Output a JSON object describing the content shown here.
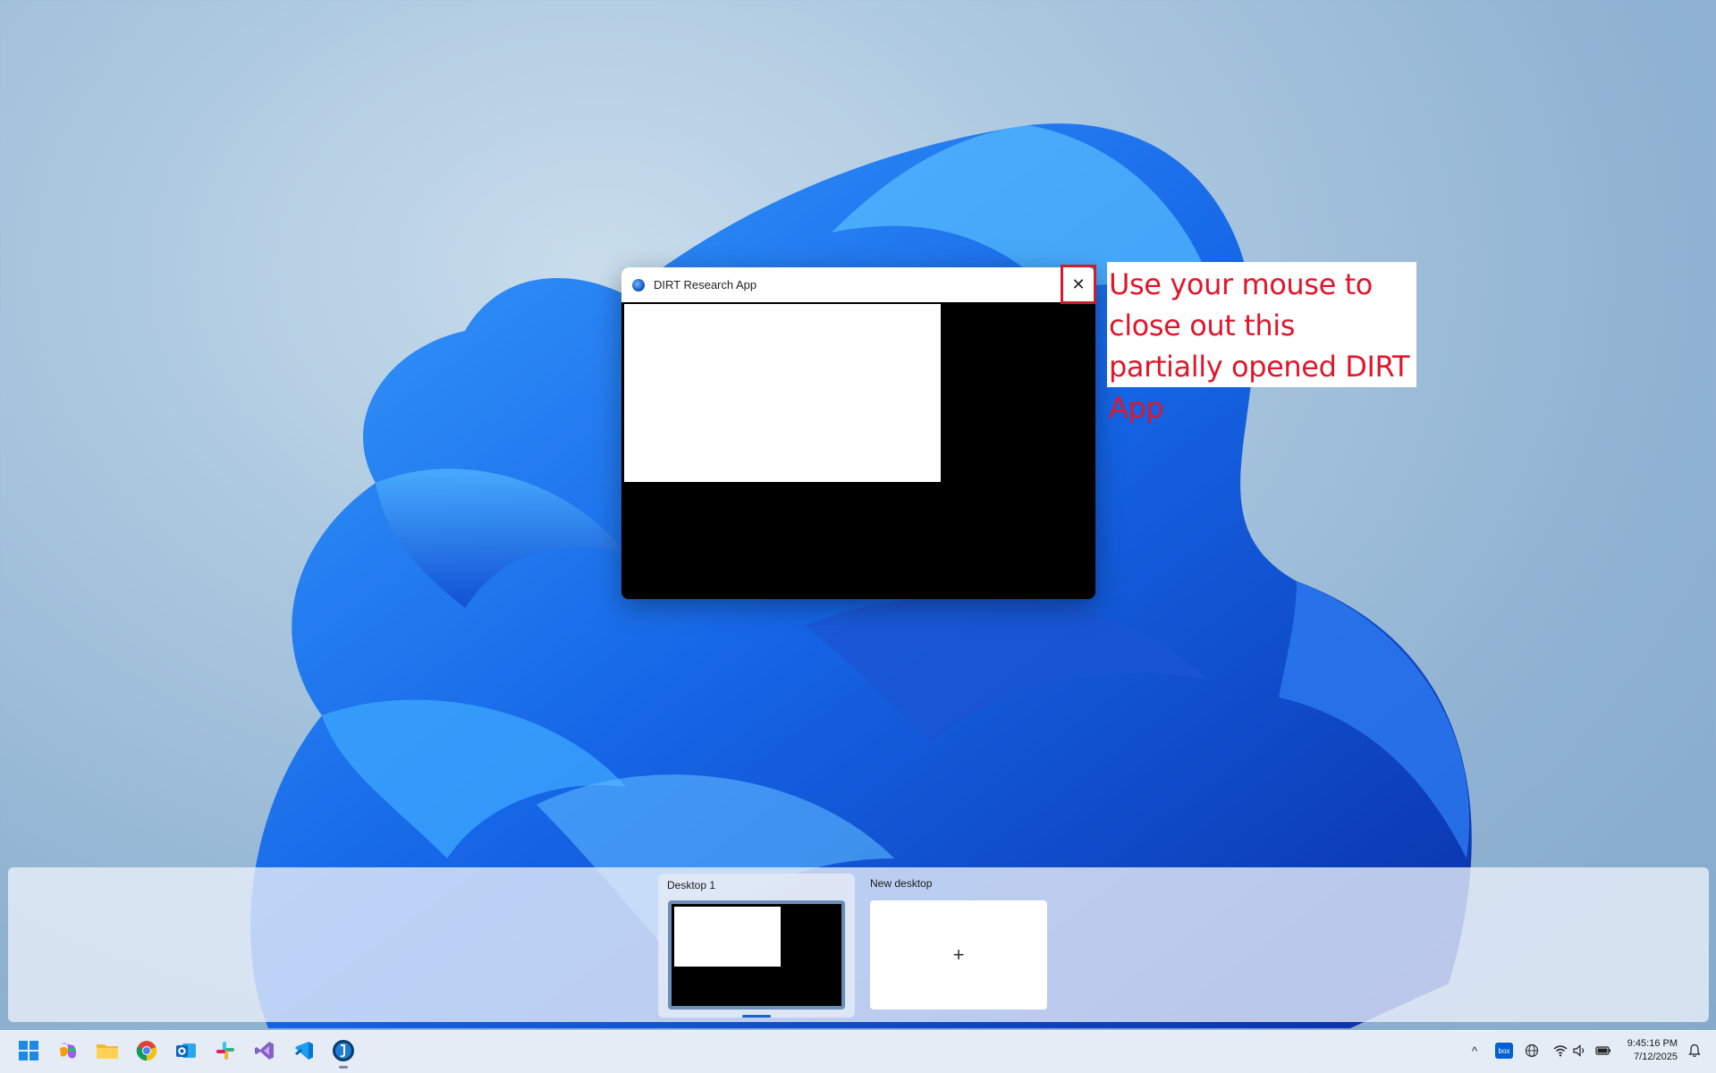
{
  "window": {
    "title": "DIRT Research App",
    "close_glyph": "✕"
  },
  "annotation": {
    "text": "Use your mouse to close out this partially opened DIRT App",
    "color": "#e0162b"
  },
  "task_view": {
    "desktop1_label": "Desktop 1",
    "new_desktop_label": "New desktop",
    "new_desktop_glyph": "+"
  },
  "taskbar": {
    "apps": [
      {
        "name": "start-icon"
      },
      {
        "name": "copilot-icon"
      },
      {
        "name": "file-explorer-icon"
      },
      {
        "name": "chrome-icon"
      },
      {
        "name": "outlook-icon"
      },
      {
        "name": "slack-icon"
      },
      {
        "name": "visual-studio-icon"
      },
      {
        "name": "vscode-icon"
      },
      {
        "name": "dirt-app-icon"
      }
    ],
    "tray": {
      "chevron_glyph": "^",
      "box_label": "box",
      "time": "9:45:16 PM",
      "date": "7/12/2025"
    }
  }
}
